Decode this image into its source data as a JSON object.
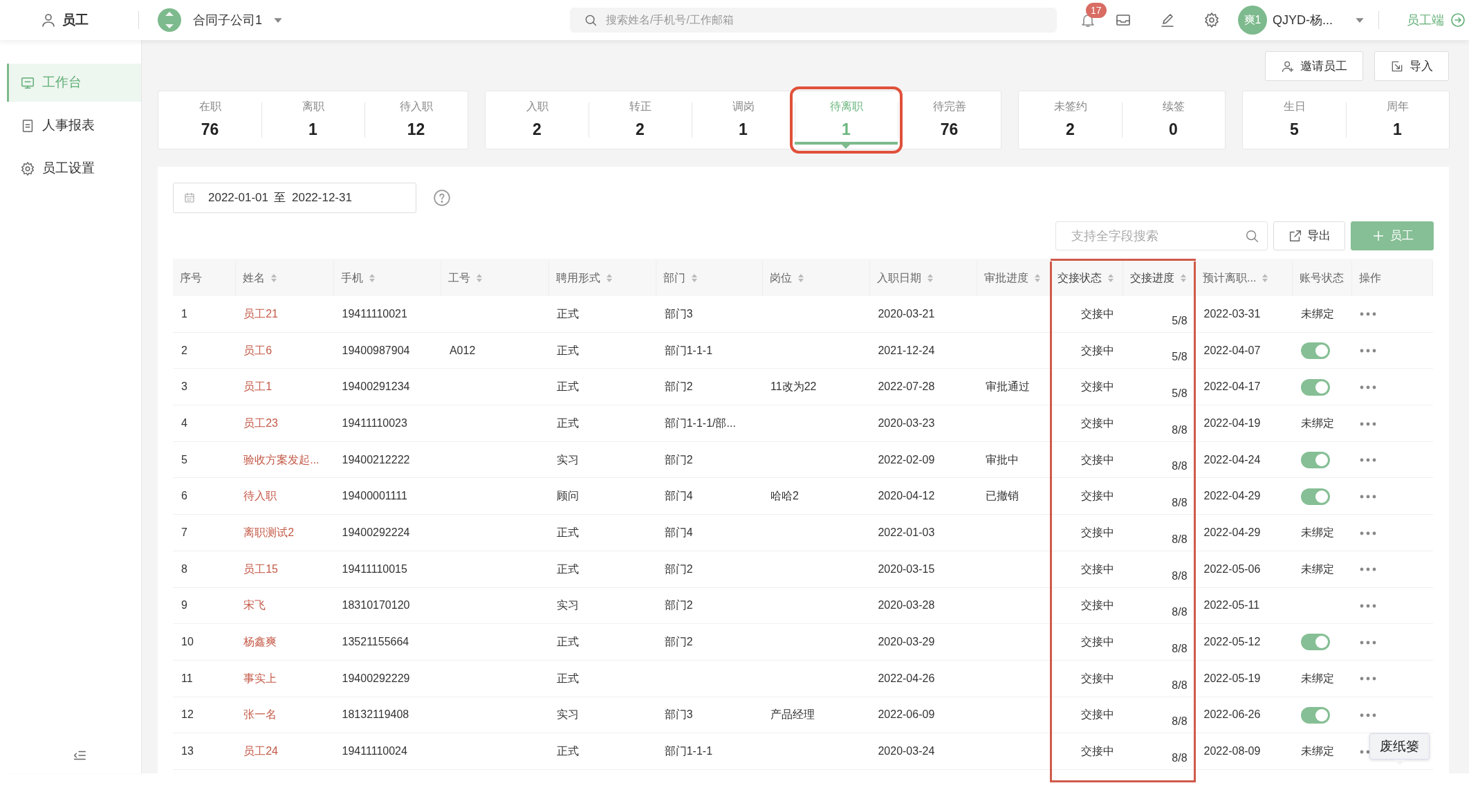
{
  "topbar": {
    "module": "员工",
    "company": "合同子公司1",
    "search_placeholder": "搜索姓名/手机号/工作邮箱",
    "notification_count": "17",
    "avatar_text": "爽1",
    "user_name": "QJYD-杨...",
    "switch_label": "员工端"
  },
  "sidebar": {
    "items": [
      {
        "label": "工作台",
        "kind": "workbench",
        "selected": true
      },
      {
        "label": "人事报表",
        "kind": "report",
        "selected": false
      },
      {
        "label": "员工设置",
        "kind": "settings",
        "selected": false
      }
    ]
  },
  "actions": [
    {
      "label": "邀请员工",
      "kind": "invite"
    },
    {
      "label": "导入",
      "kind": "import"
    }
  ],
  "stat_groups": [
    [
      {
        "label": "在职",
        "value": "76",
        "selected": false,
        "highlighted": false
      },
      {
        "label": "离职",
        "value": "1",
        "selected": false,
        "highlighted": false
      },
      {
        "label": "待入职",
        "value": "12",
        "selected": false,
        "highlighted": false
      }
    ],
    [
      {
        "label": "入职",
        "value": "2",
        "selected": false,
        "highlighted": false
      },
      {
        "label": "转正",
        "value": "2",
        "selected": false,
        "highlighted": false
      },
      {
        "label": "调岗",
        "value": "1",
        "selected": false,
        "highlighted": false
      },
      {
        "label": "待离职",
        "value": "1",
        "selected": true,
        "highlighted": true
      },
      {
        "label": "待完善",
        "value": "76",
        "selected": false,
        "highlighted": false
      }
    ],
    [
      {
        "label": "未签约",
        "value": "2",
        "selected": false,
        "highlighted": false
      },
      {
        "label": "续签",
        "value": "0",
        "selected": false,
        "highlighted": false
      }
    ],
    [
      {
        "label": "生日",
        "value": "5",
        "selected": false,
        "highlighted": false
      },
      {
        "label": "周年",
        "value": "1",
        "selected": false,
        "highlighted": false
      }
    ]
  ],
  "filters": {
    "date_from": "2022-01-01",
    "date_separator": "至",
    "date_to": "2022-12-31"
  },
  "search": {
    "placeholder": "支持全字段搜索"
  },
  "toolbar_buttons": [
    {
      "label": "导出",
      "kind": "export"
    },
    {
      "label": "员工",
      "kind": "add"
    }
  ],
  "table": {
    "columns": [
      {
        "label": "序号",
        "sortable": false,
        "highlighted": false
      },
      {
        "label": "姓名",
        "sortable": true,
        "highlighted": false
      },
      {
        "label": "手机",
        "sortable": true,
        "highlighted": false
      },
      {
        "label": "工号",
        "sortable": true,
        "highlighted": false
      },
      {
        "label": "聘用形式",
        "sortable": true,
        "highlighted": false
      },
      {
        "label": "部门",
        "sortable": true,
        "highlighted": false
      },
      {
        "label": "岗位",
        "sortable": true,
        "highlighted": false
      },
      {
        "label": "入职日期",
        "sortable": true,
        "highlighted": false
      },
      {
        "label": "审批进度",
        "sortable": true,
        "highlighted": false
      },
      {
        "label": "交接状态",
        "sortable": true,
        "highlighted": true
      },
      {
        "label": "交接进度",
        "sortable": true,
        "highlighted": true
      },
      {
        "label": "预计离职...",
        "sortable": true,
        "highlighted": false
      },
      {
        "label": "账号状态",
        "sortable": false,
        "highlighted": false
      },
      {
        "label": "操作",
        "sortable": false,
        "highlighted": false
      }
    ],
    "rows": [
      {
        "no": "1",
        "name": "员工21",
        "phone": "19411110021",
        "employee_id": "",
        "type": "正式",
        "department": "部门3",
        "position": "",
        "hire_date": "2020-03-21",
        "approval": "",
        "handover_status": "交接中",
        "handover_progress": "5/8",
        "leave_date": "2022-03-31",
        "account": {
          "kind": "text",
          "text": "未绑定"
        }
      },
      {
        "no": "2",
        "name": "员工6",
        "phone": "19400987904",
        "employee_id": "A012",
        "type": "正式",
        "department": "部门1-1-1",
        "position": "",
        "hire_date": "2021-12-24",
        "approval": "",
        "handover_status": "交接中",
        "handover_progress": "5/8",
        "leave_date": "2022-04-07",
        "account": {
          "kind": "toggle",
          "on": true
        }
      },
      {
        "no": "3",
        "name": "员工1",
        "phone": "19400291234",
        "employee_id": "",
        "type": "正式",
        "department": "部门2",
        "position": "11改为22",
        "hire_date": "2022-07-28",
        "approval": "审批通过",
        "handover_status": "交接中",
        "handover_progress": "5/8",
        "leave_date": "2022-04-17",
        "account": {
          "kind": "toggle",
          "on": true
        }
      },
      {
        "no": "4",
        "name": "员工23",
        "phone": "19411110023",
        "employee_id": "",
        "type": "正式",
        "department": "部门1-1-1/部...",
        "position": "",
        "hire_date": "2020-03-23",
        "approval": "",
        "handover_status": "交接中",
        "handover_progress": "8/8",
        "leave_date": "2022-04-19",
        "account": {
          "kind": "text",
          "text": "未绑定"
        }
      },
      {
        "no": "5",
        "name": "验收方案发起...",
        "phone": "19400212222",
        "employee_id": "",
        "type": "实习",
        "department": "部门2",
        "position": "",
        "hire_date": "2022-02-09",
        "approval": "审批中",
        "handover_status": "交接中",
        "handover_progress": "8/8",
        "leave_date": "2022-04-24",
        "account": {
          "kind": "toggle",
          "on": true
        }
      },
      {
        "no": "6",
        "name": "待入职",
        "phone": "19400001111",
        "employee_id": "",
        "type": "顾问",
        "department": "部门4",
        "position": "哈哈2",
        "hire_date": "2020-04-12",
        "approval": "已撤销",
        "handover_status": "交接中",
        "handover_progress": "8/8",
        "leave_date": "2022-04-29",
        "account": {
          "kind": "toggle",
          "on": true
        }
      },
      {
        "no": "7",
        "name": "离职测试2",
        "phone": "19400292224",
        "employee_id": "",
        "type": "正式",
        "department": "部门4",
        "position": "",
        "hire_date": "2022-01-03",
        "approval": "",
        "handover_status": "交接中",
        "handover_progress": "8/8",
        "leave_date": "2022-04-29",
        "account": {
          "kind": "text",
          "text": "未绑定"
        }
      },
      {
        "no": "8",
        "name": "员工15",
        "phone": "19411110015",
        "employee_id": "",
        "type": "正式",
        "department": "部门2",
        "position": "",
        "hire_date": "2020-03-15",
        "approval": "",
        "handover_status": "交接中",
        "handover_progress": "8/8",
        "leave_date": "2022-05-06",
        "account": {
          "kind": "text",
          "text": "未绑定"
        }
      },
      {
        "no": "9",
        "name": "宋飞",
        "phone": "18310170120",
        "employee_id": "",
        "type": "实习",
        "department": "部门2",
        "position": "",
        "hire_date": "2020-03-28",
        "approval": "",
        "handover_status": "交接中",
        "handover_progress": "8/8",
        "leave_date": "2022-05-11"
      },
      {
        "no": "10",
        "name": "杨鑫爽",
        "phone": "13521155664",
        "employee_id": "",
        "type": "正式",
        "department": "部门2",
        "position": "",
        "hire_date": "2020-03-29",
        "approval": "",
        "handover_status": "交接中",
        "handover_progress": "8/8",
        "leave_date": "2022-05-12",
        "account": {
          "kind": "toggle",
          "on": true
        }
      },
      {
        "no": "11",
        "name": "事实上",
        "phone": "19400292229",
        "employee_id": "",
        "type": "正式",
        "department": "",
        "position": "",
        "hire_date": "2022-04-26",
        "approval": "",
        "handover_status": "交接中",
        "handover_progress": "8/8",
        "leave_date": "2022-05-19",
        "account": {
          "kind": "text",
          "text": "未绑定"
        }
      },
      {
        "no": "12",
        "name": "张一名",
        "phone": "18132119408",
        "employee_id": "",
        "type": "实习",
        "department": "部门3",
        "position": "产品经理",
        "hire_date": "2022-06-09",
        "approval": "",
        "handover_status": "交接中",
        "handover_progress": "8/8",
        "leave_date": "2022-06-26",
        "account": {
          "kind": "toggle",
          "on": true
        }
      },
      {
        "no": "13",
        "name": "员工24",
        "phone": "19411110024",
        "employee_id": "",
        "type": "正式",
        "department": "部门1-1-1",
        "position": "",
        "hire_date": "2020-03-24",
        "approval": "",
        "handover_status": "交接中",
        "handover_progress": "8/8",
        "leave_date": "2022-08-09",
        "account": {
          "kind": "text",
          "text": "未绑定"
        }
      }
    ]
  },
  "tooltip": "废纸篓"
}
